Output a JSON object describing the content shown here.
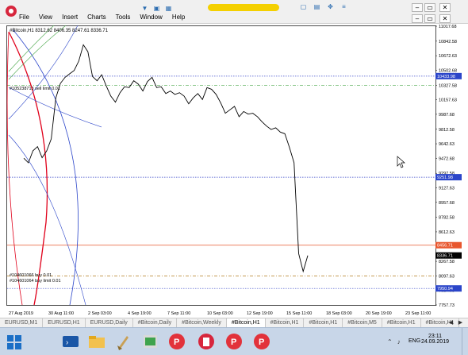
{
  "menu": {
    "items": [
      "File",
      "View",
      "Insert",
      "Charts",
      "Tools",
      "Window",
      "Help"
    ]
  },
  "chart_data": {
    "type": "line",
    "header": "#Bitcoin,H1  8312.62 8406.35 8247.61 8336.71",
    "x_tick_labels": [
      "27 Aug 2019",
      "30 Aug 11:00",
      "2 Sep 03:00",
      "4 Sep 19:00",
      "7 Sep 11:00",
      "10 Sep 03:00",
      "12 Sep 19:00",
      "15 Sep 11:00",
      "18 Sep 03:00",
      "20 Sep 19:00",
      "23 Sep 11:00"
    ],
    "y_tick_labels": [
      "11017.68",
      "10842.58",
      "10672.63",
      "10502.68",
      "10327.58",
      "10157.63",
      "9987.68",
      "9812.58",
      "9642.63",
      "9472.68",
      "9297.58",
      "9127.63",
      "8957.68",
      "8782.58",
      "8612.63",
      "8442.68",
      "8267.58",
      "8097.63",
      "7927.68",
      "7757.73"
    ],
    "ylim": [
      7757.73,
      11017.68
    ],
    "series_close": [
      9474,
      9420,
      9560,
      9610,
      9480,
      9560,
      9700,
      10180,
      10350,
      10420,
      10460,
      10500,
      10610,
      10800,
      10720,
      10430,
      10380,
      10450,
      10320,
      10200,
      10130,
      10240,
      10310,
      10300,
      10380,
      10340,
      10260,
      10370,
      10420,
      10300,
      10310,
      10230,
      10260,
      10220,
      10240,
      10200,
      10110,
      10180,
      10230,
      10160,
      10300,
      10280,
      10220,
      10120,
      10000,
      10040,
      10080,
      9960,
      10020,
      9990,
      10000,
      9960,
      9900,
      9850,
      9810,
      9830,
      9780,
      9760,
      9600,
      9420,
      8360,
      8150,
      8336.71
    ],
    "price_labels": [
      {
        "value": "10433.98",
        "color": "#2b45c9"
      },
      {
        "value": "9251.98",
        "color": "#2b45c9"
      },
      {
        "value": "8456.71",
        "color": "#e8572e"
      },
      {
        "value": "8336.71",
        "color": "#000000"
      },
      {
        "value": "7950.94",
        "color": "#2b45c9"
      }
    ],
    "order_labels": [
      "#105238713 sell limit 0.01",
      "#104601066 buy 0.01",
      "#104601064 buy limit 0.01"
    ],
    "horizontal_lines": [
      {
        "value": 10433.98,
        "color": "#3b49c9",
        "style": "dotted"
      },
      {
        "value": 10327.58,
        "color": "#4aa84a",
        "style": "dashdot"
      },
      {
        "value": 9251.98,
        "color": "#3b49c9",
        "style": "dotted"
      },
      {
        "value": 8456.71,
        "color": "#e8572e",
        "style": "solid"
      },
      {
        "value": 8097.63,
        "color": "#b07a1a",
        "style": "dashdot"
      },
      {
        "value": 7950.94,
        "color": "#3b49c9",
        "style": "dotted"
      }
    ]
  },
  "tabs": [
    "EURUSD,M1",
    "EURUSD,H1",
    "EURUSD,Daily",
    "#Bitcoin,Daily",
    "#Bitcoin,Weekly",
    "#Bitcoin,H1",
    "#Bitcoin,H1",
    "#Bitcoin,H1",
    "#Bitcoin,M5",
    "#Bitcoin,H1",
    "#Bitcoin,H1"
  ],
  "taskbar": {
    "lang": "ENG",
    "time": "23:11",
    "date": "24.09.2019"
  },
  "colors": {
    "accent_red": "#d7263d",
    "line_blue": "#3b49c9",
    "line_green": "#4aa84a"
  }
}
